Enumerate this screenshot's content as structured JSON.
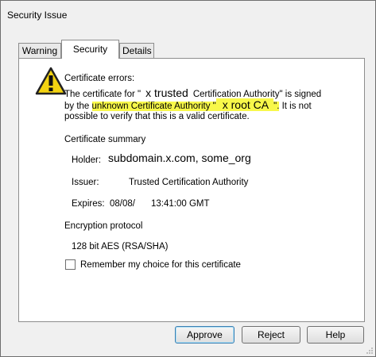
{
  "window": {
    "title": "Security Issue"
  },
  "tabs": [
    {
      "label": "Warning"
    },
    {
      "label": "Security"
    },
    {
      "label": "Details"
    }
  ],
  "panel": {
    "cert_errors_heading": "Certificate errors:",
    "error_line1_prefix": "The certificate for \"",
    "error_line1_name": "x trusted",
    "error_line1_suffix": "Certification Authority\" is signed",
    "error_line2_prefix": "by the",
    "error_line2_highlight1": "unknown Certificate Authority \"",
    "error_line2_highlight2": "x root CA",
    "error_line2_mark": "\".",
    "error_line2_suffix": "It is not",
    "error_line3": "possible to verify that this is a valid certificate.",
    "summary_heading": "Certificate summary",
    "holder_label": "Holder:",
    "holder_value": "subdomain.x.com, some_org",
    "issuer_label": "Issuer:",
    "issuer_value": "Trusted Certification Authority",
    "expires_label": "Expires:",
    "expires_date": "08/08/",
    "expires_time": "13:41:00 GMT",
    "encryption_heading": "Encryption protocol",
    "encryption_value": "128 bit AES (RSA/SHA)",
    "remember_label": "Remember my choice for this certificate",
    "remember_checked": false
  },
  "buttons": {
    "approve": "Approve",
    "reject": "Reject",
    "help": "Help"
  },
  "colors": {
    "highlight": "#f8f84a",
    "warning_yellow": "#f3d311"
  }
}
